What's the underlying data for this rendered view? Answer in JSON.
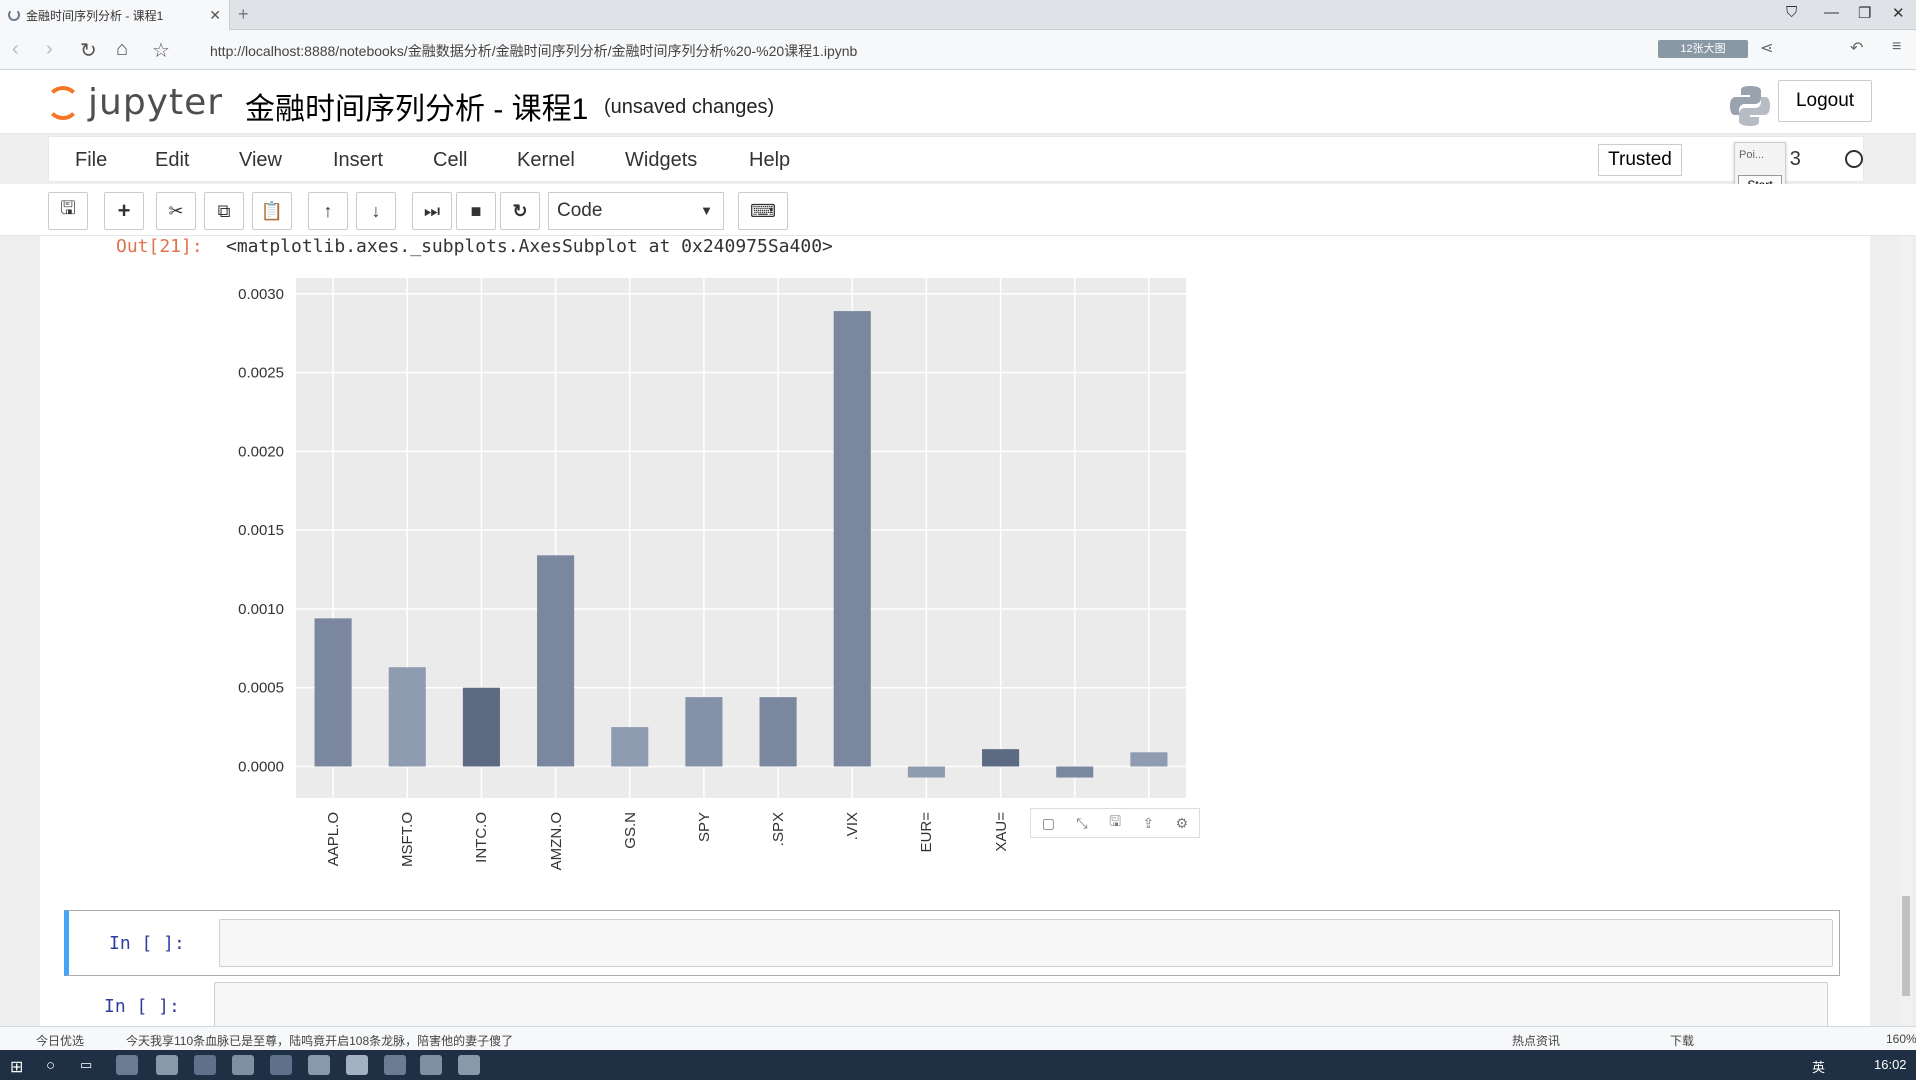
{
  "browser": {
    "tab_title": "金融时间序列分析 - 课程1",
    "url": "http://localhost:8888/notebooks/金融数据分析/金融时间序列分析/金融时间序列分析%20-%20课程1.ipynb",
    "badge": "12张大图"
  },
  "header": {
    "logo_text": "jupyter",
    "notebook_title": "金融时间序列分析 - 课程1",
    "save_status": "(unsaved changes)",
    "logout_label": "Logout"
  },
  "menu": {
    "items": [
      "File",
      "Edit",
      "View",
      "Insert",
      "Cell",
      "Kernel",
      "Widgets",
      "Help"
    ],
    "trusted_label": "Trusted",
    "kernel_label": "on 3",
    "popup_text": "Poi...",
    "popup_button": "Start"
  },
  "toolbar": {
    "cell_type": "Code"
  },
  "output": {
    "prompt": "Out[21]:",
    "text": "<matplotlib.axes._subplots.AxesSubplot at 0x240975Sa400>"
  },
  "chart_data": {
    "type": "bar",
    "categories": [
      "AAPL.O",
      "MSFT.O",
      "INTC.O",
      "AMZN.O",
      "GS.N",
      "SPY",
      ".SPX",
      ".VIX",
      "EUR=",
      "XAU=",
      "GL",
      "GL"
    ],
    "values": [
      0.00094,
      0.00063,
      0.0005,
      0.00134,
      0.00025,
      0.00044,
      0.00044,
      0.00289,
      -7e-05,
      0.00011,
      -7e-05,
      9e-05
    ],
    "yticks": [
      "0.0000",
      "0.0005",
      "0.0010",
      "0.0015",
      "0.0020",
      "0.0025",
      "0.0030"
    ],
    "ylim": [
      -0.0002,
      0.0031
    ],
    "grid": true,
    "colors": [
      "#7a879e",
      "#8f9bb0",
      "#5c6a82",
      "#7a879e",
      "#8f9bb0",
      "#8591a8",
      "#7a879e",
      "#7a879e",
      "#8f9bb0",
      "#5c6a82",
      "#7a879e",
      "#8f9bb0"
    ]
  },
  "cells": [
    {
      "prompt": "In [ ]:"
    },
    {
      "prompt": "In [ ]:"
    }
  ],
  "statusbar": {
    "left_label": "今日优选",
    "news": "今天我享110条血脉已是至尊，陆鸣竟开启108条龙脉，陪害他的妻子傻了",
    "hot": "热点资讯",
    "download": "下载",
    "zoom": "160%"
  },
  "taskbar": {
    "ime": "英",
    "time": "16:02"
  }
}
